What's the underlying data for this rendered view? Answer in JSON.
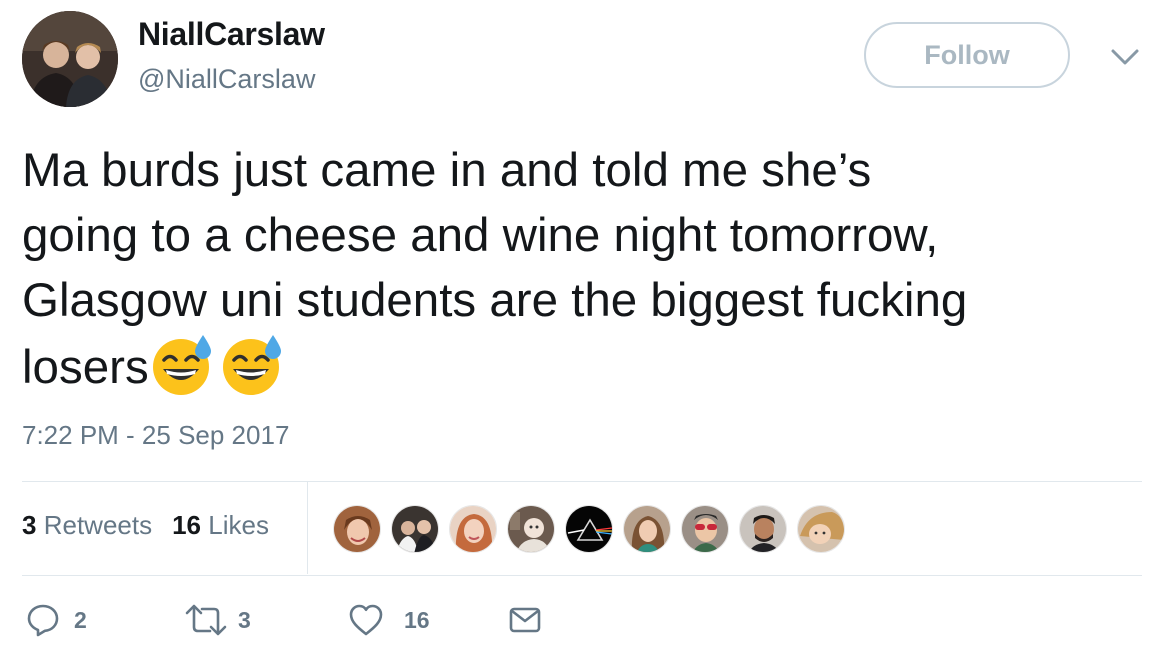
{
  "header": {
    "display_name": "NiallCarslaw",
    "handle": "@NiallCarslaw",
    "follow_label": "Follow",
    "menu_icon": "chevron-down-icon"
  },
  "tweet": {
    "text_lines": [
      "Ma burds just came in and told me she’s",
      "going to a cheese and wine night tomorrow,",
      "Glasgow uni students are the biggest fucking",
      "losers"
    ],
    "emoji": [
      "grinning-face-with-sweat",
      "grinning-face-with-sweat"
    ],
    "timestamp": "7:22 PM - 25 Sep 2017"
  },
  "stats": {
    "retweets_count": "3",
    "retweets_label": "Retweets",
    "likes_count": "16",
    "likes_label": "Likes",
    "liker_avatar_count": 9
  },
  "actions": {
    "reply_count": "2",
    "retweet_count": "3",
    "like_count": "16"
  },
  "colors": {
    "text": "#14171a",
    "secondary": "#657786",
    "border": "#e1e8ed",
    "follow_border": "#c8d4dd",
    "follow_text": "#aab8c2"
  }
}
